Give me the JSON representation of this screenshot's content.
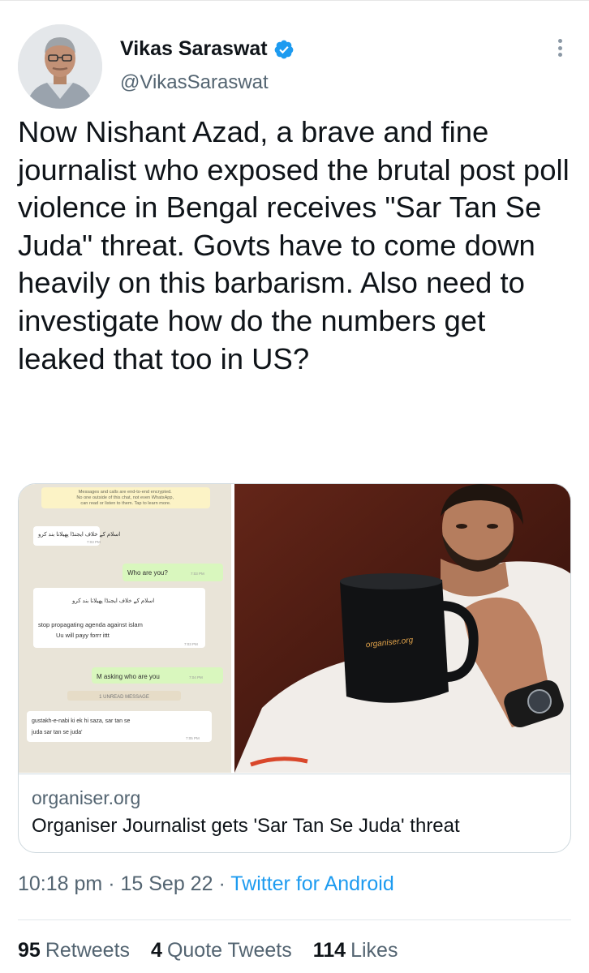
{
  "author": {
    "display_name": "Vikas Saraswat",
    "handle": "@VikasSaraswat",
    "verified": true,
    "verified_color": "#1d9bf0"
  },
  "tweet": {
    "text": "Now Nishant Azad, a brave and fine journalist who exposed the brutal post poll violence in Bengal receives \"Sar Tan Se Juda\" threat. Govts have to come down heavily on this barbarism. Also need to investigate how do the numbers get leaked that too in US?"
  },
  "card": {
    "domain": "organiser.org",
    "title": "Organiser Journalist gets 'Sar Tan Se Juda' threat",
    "chat": {
      "encryption_notice": "Messages and calls are end-to-end encrypted. No one outside of this chat, not even WhatsApp, can read or listen to them. Tap to learn more.",
      "messages": [
        {
          "text": "اسلام کے خلاف ایجنڈا پھیلانا بند کرو",
          "time": "7:03 PM"
        },
        {
          "text": "Who are you?",
          "time": "7:03 PM"
        },
        {
          "text": "اسلام کے خلاف ایجنڈا پھیلانا بند کرو",
          "time": ""
        },
        {
          "text": "stop propagating agenda against islam",
          "time": ""
        },
        {
          "text": "Uu will payy forrr ittt",
          "time": "7:03 PM"
        },
        {
          "text": "M asking who are you",
          "time": "7:04 PM"
        },
        {
          "text": "gustakh-e-nabi ki ek hi saza, sar tan se",
          "time": ""
        },
        {
          "text": "juda sar tan se juda'",
          "time": "7:05 PM"
        }
      ],
      "unread_label": "1 UNREAD MESSAGE"
    },
    "mug_text": "organiser.org"
  },
  "meta": {
    "time": "10:18 pm",
    "date": "15 Sep 22",
    "dot": "·",
    "source": "Twitter for Android"
  },
  "stats": {
    "retweets_count": "95",
    "retweets_label": "Retweets",
    "quotes_count": "4",
    "quotes_label": "Quote Tweets",
    "likes_count": "114",
    "likes_label": "Likes"
  }
}
